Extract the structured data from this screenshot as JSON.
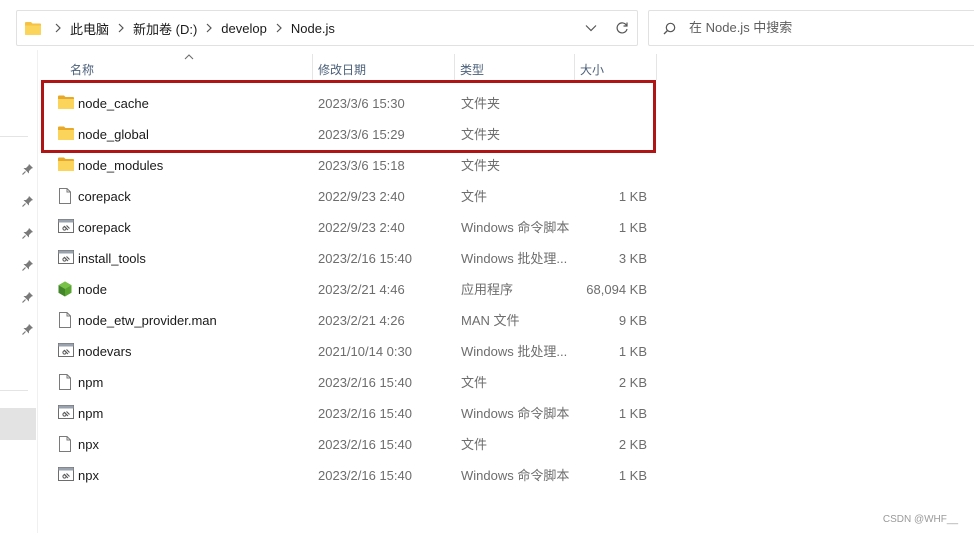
{
  "address_bar": {
    "crumbs": [
      "此电脑",
      "新加卷 (D:)",
      "develop",
      "Node.js"
    ]
  },
  "search": {
    "placeholder": "在 Node.js 中搜索"
  },
  "columns": {
    "name": "名称",
    "date": "修改日期",
    "type": "类型",
    "size": "大小"
  },
  "files": [
    {
      "name": "node_cache",
      "date": "2023/3/6 15:30",
      "type": "文件夹",
      "size": "",
      "icon": "folder-icon"
    },
    {
      "name": "node_global",
      "date": "2023/3/6 15:29",
      "type": "文件夹",
      "size": "",
      "icon": "folder-icon"
    },
    {
      "name": "node_modules",
      "date": "2023/3/6 15:18",
      "type": "文件夹",
      "size": "",
      "icon": "folder-icon"
    },
    {
      "name": "corepack",
      "date": "2022/9/23 2:40",
      "type": "文件",
      "size": "1 KB",
      "icon": "file-icon"
    },
    {
      "name": "corepack",
      "date": "2022/9/23 2:40",
      "type": "Windows 命令脚本",
      "size": "1 KB",
      "icon": "script-icon"
    },
    {
      "name": "install_tools",
      "date": "2023/2/16 15:40",
      "type": "Windows 批处理...",
      "size": "3 KB",
      "icon": "script-icon"
    },
    {
      "name": "node",
      "date": "2023/2/21 4:46",
      "type": "应用程序",
      "size": "68,094 KB",
      "icon": "node-app-icon"
    },
    {
      "name": "node_etw_provider.man",
      "date": "2023/2/21 4:26",
      "type": "MAN 文件",
      "size": "9 KB",
      "icon": "file-icon"
    },
    {
      "name": "nodevars",
      "date": "2021/10/14 0:30",
      "type": "Windows 批处理...",
      "size": "1 KB",
      "icon": "script-icon"
    },
    {
      "name": "npm",
      "date": "2023/2/16 15:40",
      "type": "文件",
      "size": "2 KB",
      "icon": "file-icon"
    },
    {
      "name": "npm",
      "date": "2023/2/16 15:40",
      "type": "Windows 命令脚本",
      "size": "1 KB",
      "icon": "script-icon"
    },
    {
      "name": "npx",
      "date": "2023/2/16 15:40",
      "type": "文件",
      "size": "2 KB",
      "icon": "file-icon"
    },
    {
      "name": "npx",
      "date": "2023/2/16 15:40",
      "type": "Windows 命令脚本",
      "size": "1 KB",
      "icon": "script-icon"
    }
  ],
  "colors": {
    "highlight_border": "#b01515",
    "folder": "#f5c241",
    "node_green": "#5aa532"
  },
  "watermark": "CSDN @WHF__"
}
